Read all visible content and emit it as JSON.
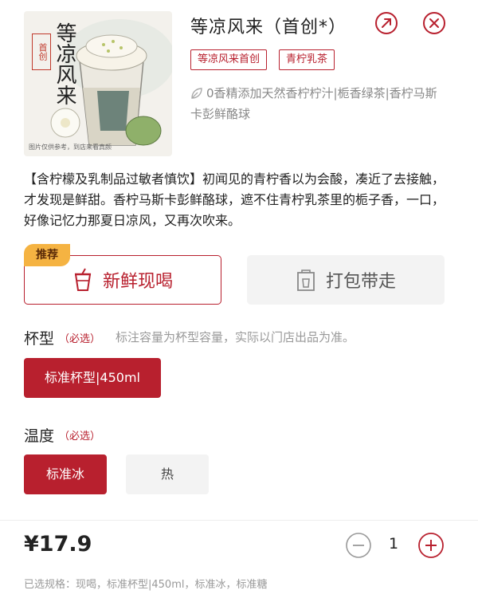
{
  "product": {
    "title": "等凉风来（首创*）",
    "image_caption": "图片仅供参考，到店来看真颜",
    "image_text": "等凉风来",
    "image_seal": "首创",
    "tags": [
      "等凉风来首创",
      "青柠乳茶"
    ],
    "ingredients": "0香精添加天然香柠柠汁|栀香绿茶|香柠马斯卡彭鲜酪球",
    "description": "【含柠檬及乳制品过敏者慎饮】初闻见的青柠香以为会酸，凑近了去接触，才发现是鲜甜。香柠马斯卡彭鲜酪球，遮不住青柠乳茶里的栀子香，一口，好像记忆力那夏日凉风，又再次吹来。"
  },
  "mode": {
    "badge": "推荐",
    "fresh_label": "新鲜现喝",
    "pack_label": "打包带走"
  },
  "cup": {
    "label": "杯型",
    "required": "（必选）",
    "note": "标注容量为杯型容量，实际以门店出品为准。",
    "options": [
      "标准杯型|450ml"
    ]
  },
  "temperature": {
    "label": "温度",
    "required": "（必选）",
    "options": [
      "标准冰",
      "热"
    ]
  },
  "footer": {
    "price": "¥17.9",
    "quantity": "1",
    "selected_spec": "已选规格：现喝，标准杯型|450ml，标准冰，标准糖"
  },
  "colors": {
    "accent": "#b8202e",
    "badge": "#f5b342"
  },
  "icons": [
    "share-icon",
    "close-icon",
    "leaf-icon",
    "cup-icon",
    "bag-icon",
    "minus-icon",
    "plus-icon"
  ]
}
